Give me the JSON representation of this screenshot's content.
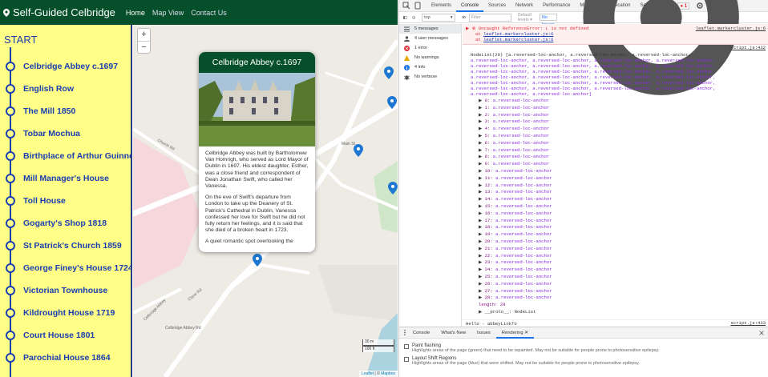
{
  "app": {
    "brand": "Self-Guided Celbridge",
    "nav": [
      "Home",
      "Map View",
      "Contact Us"
    ]
  },
  "sidebar": {
    "start_label": "START",
    "stops": [
      "Celbridge Abbey c.1697",
      "English Row",
      "The Mill 1850",
      "Tobar Mochua",
      "Birthplace of Arthur Guinness",
      "Mill Manager's House",
      "Toll House",
      "Gogarty's Shop 1818",
      "St Patrick's Church 1859",
      "George Finey's House 1724",
      "Victorian Townhouse",
      "Kildrought House 1719",
      "Court House 1801",
      "Parochial House 1864"
    ]
  },
  "map": {
    "zoom_in": "+",
    "zoom_out": "−",
    "popup": {
      "title": "Celbridge Abbey c.1697",
      "paragraphs": [
        "Celbridge Abbey was built by Bartholomew Van Homrigh, who served as Lord Mayor of Dublin in 1697. His eldest daughter, Esther, was a close friend and correspondent of Dean Jonathan Swift, who called her Vanessa.",
        "On the eve of Swift's departure from London to take up the Deanery of St. Patrick's Cathedral in Dublin, Vanessa confessed her love for Swift but he did not fully return her feelings, and it is said that she died of a broken heart in 1723.",
        "A quiet romantic spot overlooking the"
      ]
    },
    "street_labels": [
      "Church Rd",
      "Main St",
      "Clane Rd",
      "Celbridge Abbey",
      "Celbridge Abbey Rd"
    ],
    "scale": [
      "30 m",
      "100 ft"
    ],
    "attribution_leaflet": "Leaflet",
    "attribution_sep": " | © ",
    "attribution_mapbox": "Mapbox"
  },
  "devtools": {
    "tabs": [
      "Elements",
      "Console",
      "Sources",
      "Network",
      "Performance",
      "Memory",
      "Application",
      "Security"
    ],
    "more": "»",
    "error_count": "1",
    "context": "top",
    "filter_placeholder": "Filter",
    "levels": "Default levels ▾",
    "issues": "No Issues",
    "sidebar": [
      {
        "label": "5 messages",
        "icon": "list-icon",
        "color": "#555"
      },
      {
        "label": "4 user messages",
        "icon": "user-icon",
        "color": "#555"
      },
      {
        "label": "1 error",
        "icon": "error-icon",
        "color": "#e0303a"
      },
      {
        "label": "No warnings",
        "icon": "warning-icon",
        "color": "#e8a600"
      },
      {
        "label": "4 info",
        "icon": "info-icon",
        "color": "#1a73e8"
      },
      {
        "label": "No verbose",
        "icon": "bug-icon",
        "color": "#555"
      }
    ],
    "error": {
      "message": "Uncaught ReferenceError: L is not defined",
      "source": "leaflet.markercluster.js:6",
      "stack": [
        {
          "at": "at ",
          "link": "leaflet.markercluster.js:6"
        },
        {
          "at": "at ",
          "link": "leaflet.markercluster.js:6"
        }
      ]
    },
    "nodelist_source": "script.js:432",
    "nodelist_header_lines": [
      "NodeList(29) [a.reversed-loc-anchor, a.reversed-loc-anchor, a.reversed-loc-anchor,",
      "a.reversed-loc-anchor, a.reversed-loc-anchor, a.reversed-loc-anchor, a.reversed-loc-anchor,",
      "a.reversed-loc-anchor, a.reversed-loc-anchor, a.reversed-loc-anchor, a.reversed-loc-anchor,",
      "a.reversed-loc-anchor, a.reversed-loc-anchor, a.reversed-loc-anchor, a.reversed-loc-anchor,",
      "a.reversed-loc-anchor, a.reversed-loc-anchor, a.reversed-loc-anchor, a.reversed-loc-anchor,",
      "a.reversed-loc-anchor, a.reversed-loc-anchor, a.reversed-loc-anchor, a.reversed-loc-anchor,",
      "a.reversed-loc-anchor, a.reversed-loc-anchor, a.reversed-loc-anchor, a.reversed-loc-anchor,",
      "a.reversed-loc-anchor, a.reversed-loc-anchor]"
    ],
    "node_item": "a.reversed-loc-anchor",
    "node_count": 29,
    "length_line": "length: 29",
    "proto_line": "▶ __proto__: NodeList",
    "hello_line": "Hello - abbeyLinkTo",
    "hello_source": "script.js:433",
    "bottom_tabs": [
      "Console",
      "What's New",
      "Issues",
      "Rendering ✕"
    ],
    "rendering": [
      {
        "title": "Paint flashing",
        "desc": "Highlights areas of the page (green) that need to be repainted. May not be suitable for people prone to photosensitive epilepsy."
      },
      {
        "title": "Layout Shift Regions",
        "desc": "Highlights areas of the page (blue) that were shifted. May not be suitable for people prone to photosensitive epilepsy."
      }
    ]
  }
}
